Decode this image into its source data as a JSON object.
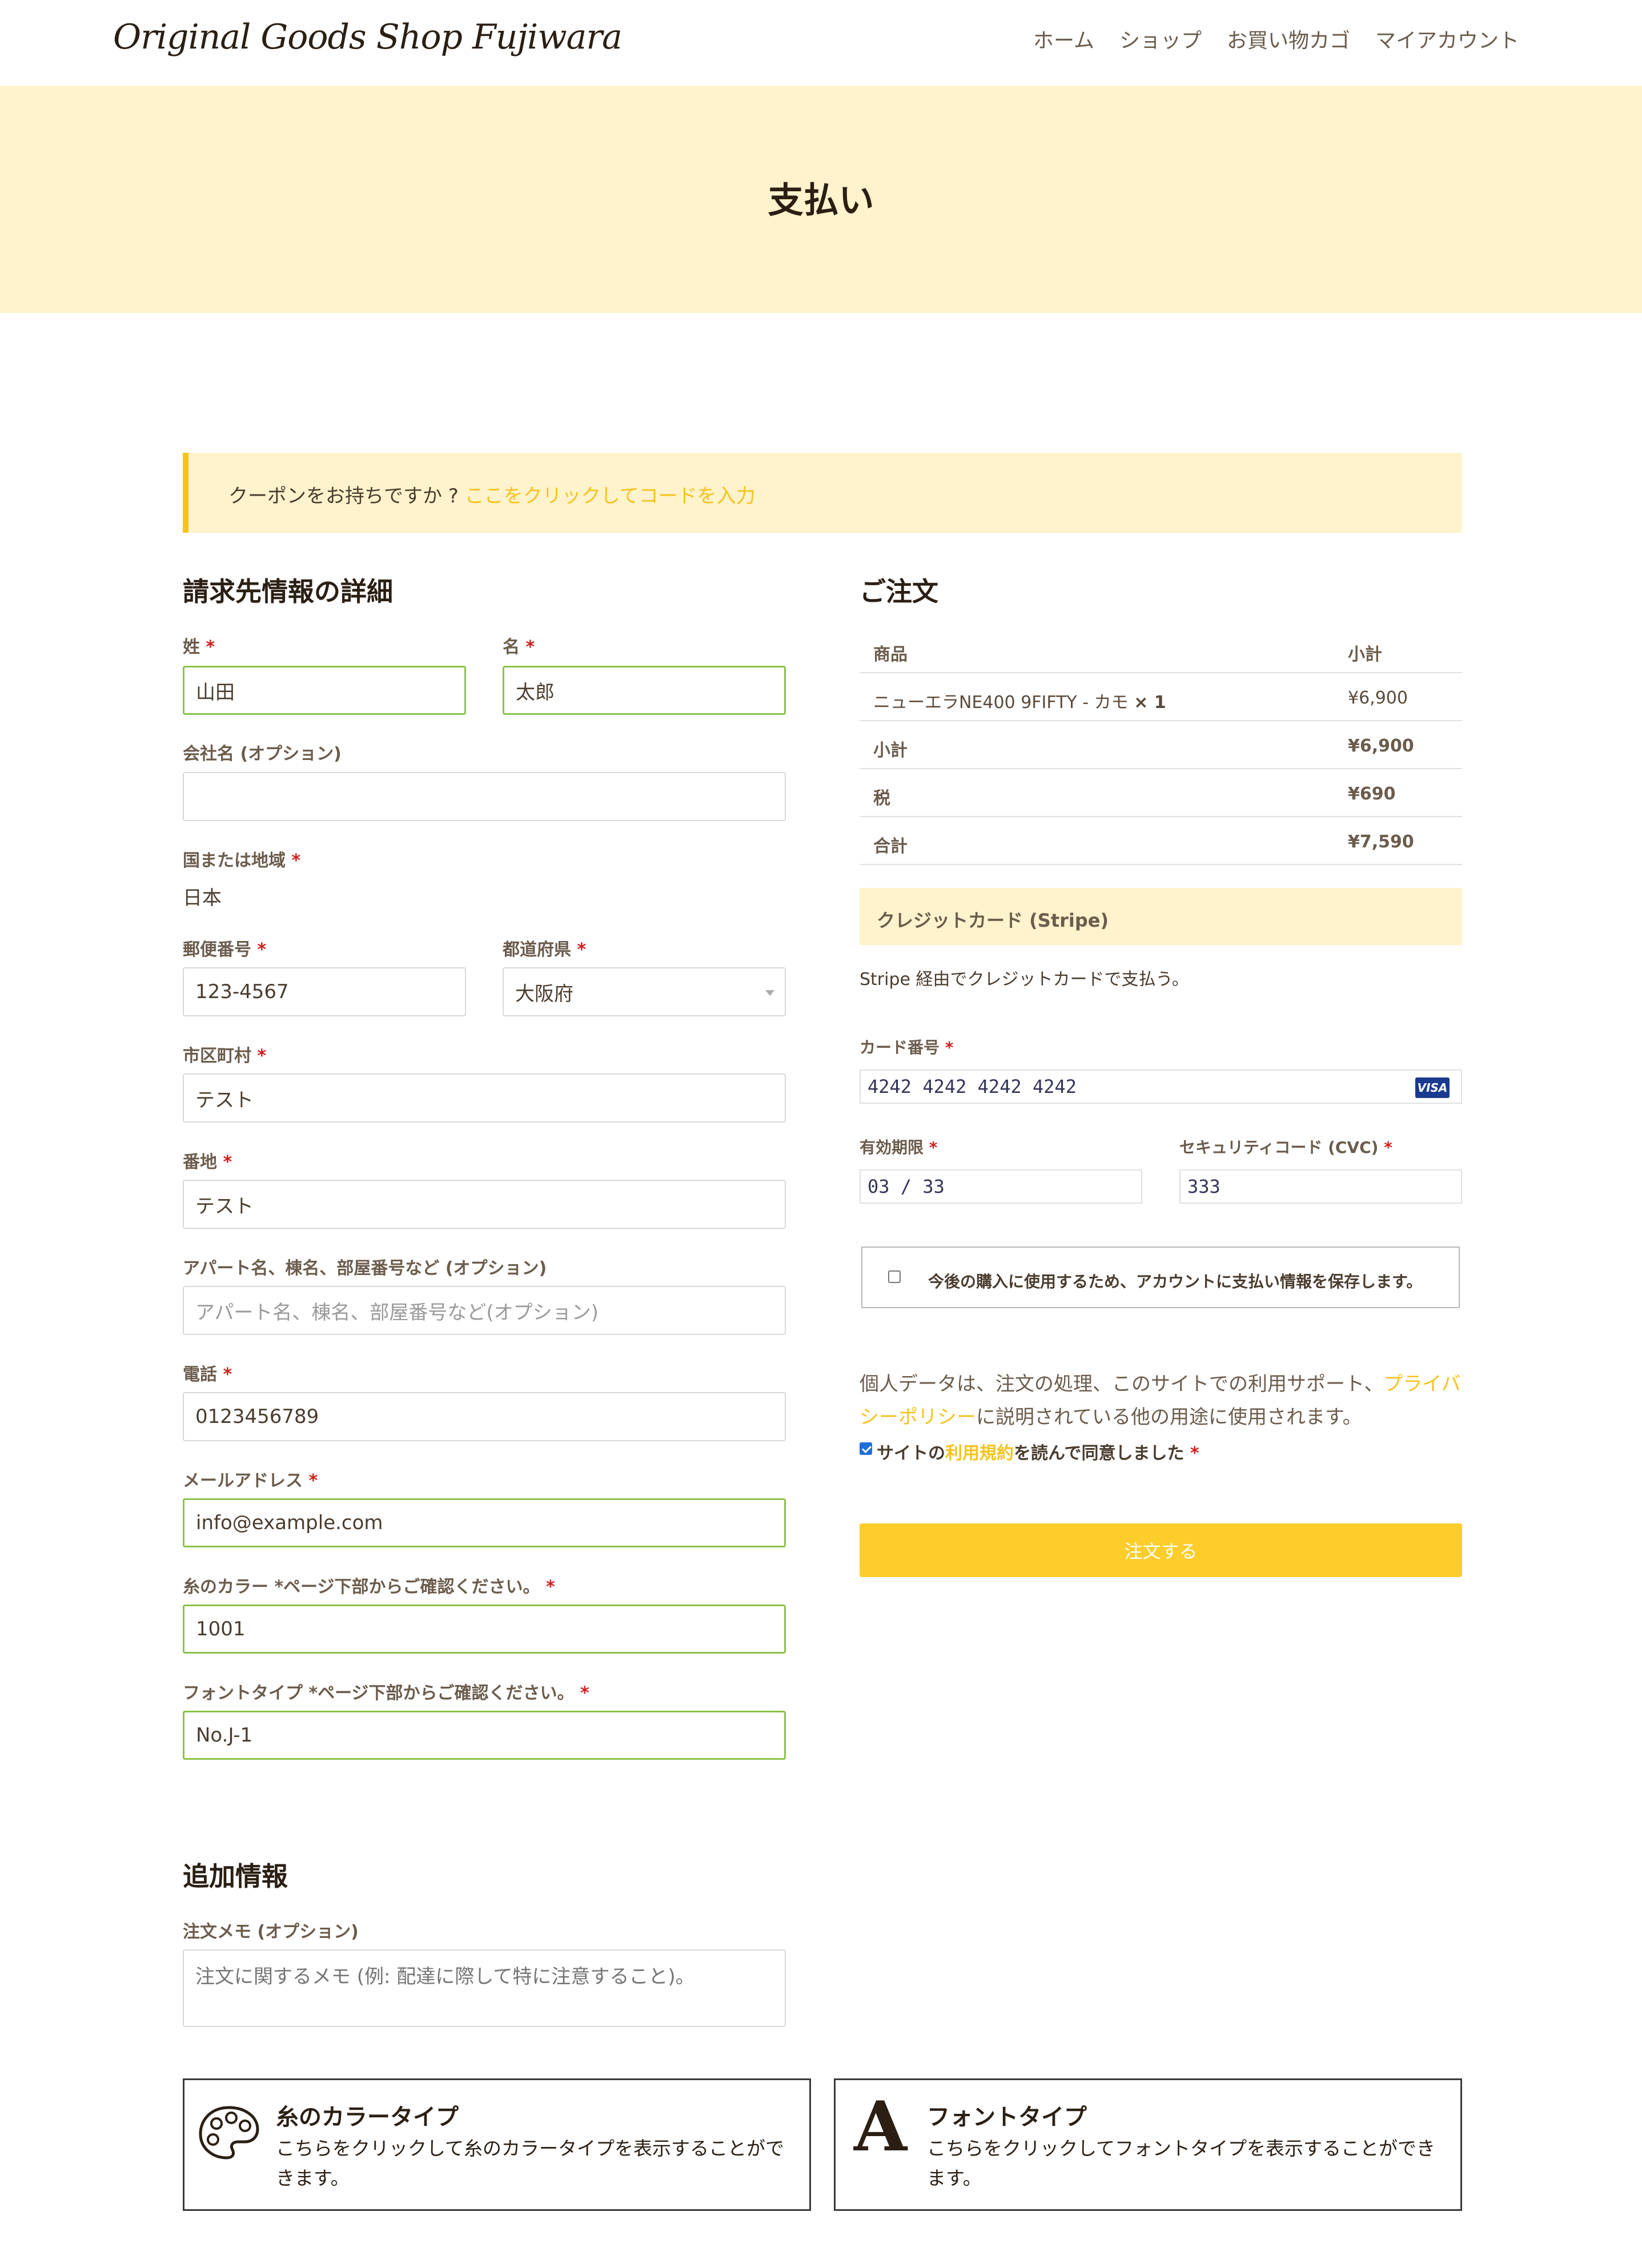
{
  "header": {
    "logo": "Original Goods Shop Fujiwara",
    "nav": [
      "ホーム",
      "ショップ",
      "お買い物カゴ",
      "マイアカウント"
    ]
  },
  "hero": {
    "title": "支払い"
  },
  "coupon": {
    "text": "クーポンをお持ちですか ? ",
    "link": "ここをクリックしてコードを入力"
  },
  "billing": {
    "heading": "請求先情報の詳細",
    "last_name": {
      "label": "姓",
      "value": "山田"
    },
    "first_name": {
      "label": "名",
      "value": "太郎"
    },
    "company": {
      "label": "会社名 (オプション)",
      "value": ""
    },
    "country": {
      "label": "国または地域",
      "value": "日本"
    },
    "postcode": {
      "label": "郵便番号",
      "value": "123-4567"
    },
    "prefecture": {
      "label": "都道府県",
      "value": "大阪府"
    },
    "city": {
      "label": "市区町村",
      "value": "テスト"
    },
    "address": {
      "label": "番地",
      "value": "テスト"
    },
    "apartment": {
      "label": "アパート名、棟名、部屋番号など (オプション)",
      "placeholder": "アパート名、棟名、部屋番号など(オプション)"
    },
    "phone": {
      "label": "電話",
      "value": "0123456789"
    },
    "email": {
      "label": "メールアドレス",
      "value": "info@example.com"
    },
    "thread_color": {
      "label": "糸のカラー *ページ下部からご確認ください。",
      "value": "1001"
    },
    "font_type": {
      "label": "フォントタイプ *ページ下部からご確認ください。",
      "value": "No.J-1"
    },
    "required_mark": "*"
  },
  "additional": {
    "heading": "追加情報",
    "notes_label": "注文メモ (オプション)",
    "notes_placeholder": "注文に関するメモ (例: 配達に際して特に注意すること)。"
  },
  "order": {
    "heading": "ご注文",
    "col_product": "商品",
    "col_subtotal": "小計",
    "item_name": "ニューエラNE400 9FIFTY - カモ",
    "item_qty": "× 1",
    "item_price": "¥6,900",
    "subtotal_label": "小計",
    "subtotal_value": "¥6,900",
    "tax_label": "税",
    "tax_value": "¥690",
    "total_label": "合計",
    "total_value": "¥7,590"
  },
  "payment": {
    "method": "クレジットカード (Stripe)",
    "description": "Stripe 経由でクレジットカードで支払う。",
    "card_label": "カード番号",
    "card_value": "4242 4242 4242 4242",
    "card_brand": "VISA",
    "expiry_label": "有効期限",
    "expiry_value": "03 / 33",
    "cvc_label": "セキュリティコード (CVC)",
    "cvc_value": "333",
    "save_label": "今後の購入に使用するため、アカウントに支払い情報を保存します。",
    "save_checked": false
  },
  "privacy": {
    "text1": "個人データは、注文の処理、このサイトでの利用サポート、",
    "link": "プライバシーポリシー",
    "text2": "に説明されている他の用途に使用されます。"
  },
  "terms": {
    "text1": "サイトの",
    "link": "利用規約",
    "text2": "を読んで同意しました",
    "checked": true
  },
  "place_order": "注文する",
  "info_boxes": [
    {
      "title": "糸のカラータイプ",
      "desc": "こちらをクリックして糸のカラータイプを表示することができます。",
      "icon": "palette-icon"
    },
    {
      "title": "フォントタイプ",
      "desc": "こちらをクリックしてフォントタイプを表示することができます。",
      "icon": "font-a-icon"
    }
  ],
  "colors": {
    "accent": "#f6c31c",
    "hero_bg": "#fef3cc",
    "valid_border": "#8bc34a",
    "required": "#d0201e",
    "button": "#fdcd2b"
  }
}
